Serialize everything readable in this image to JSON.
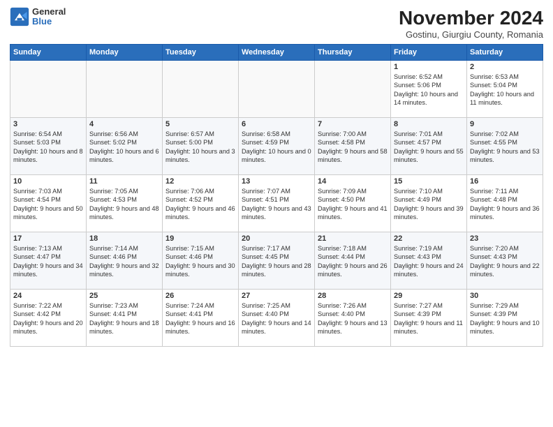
{
  "header": {
    "logo_general": "General",
    "logo_blue": "Blue",
    "title": "November 2024",
    "location": "Gostinu, Giurgiu County, Romania"
  },
  "days_of_week": [
    "Sunday",
    "Monday",
    "Tuesday",
    "Wednesday",
    "Thursday",
    "Friday",
    "Saturday"
  ],
  "weeks": [
    [
      {
        "day": "",
        "info": ""
      },
      {
        "day": "",
        "info": ""
      },
      {
        "day": "",
        "info": ""
      },
      {
        "day": "",
        "info": ""
      },
      {
        "day": "",
        "info": ""
      },
      {
        "day": "1",
        "info": "Sunrise: 6:52 AM\nSunset: 5:06 PM\nDaylight: 10 hours and 14 minutes."
      },
      {
        "day": "2",
        "info": "Sunrise: 6:53 AM\nSunset: 5:04 PM\nDaylight: 10 hours and 11 minutes."
      }
    ],
    [
      {
        "day": "3",
        "info": "Sunrise: 6:54 AM\nSunset: 5:03 PM\nDaylight: 10 hours and 8 minutes."
      },
      {
        "day": "4",
        "info": "Sunrise: 6:56 AM\nSunset: 5:02 PM\nDaylight: 10 hours and 6 minutes."
      },
      {
        "day": "5",
        "info": "Sunrise: 6:57 AM\nSunset: 5:00 PM\nDaylight: 10 hours and 3 minutes."
      },
      {
        "day": "6",
        "info": "Sunrise: 6:58 AM\nSunset: 4:59 PM\nDaylight: 10 hours and 0 minutes."
      },
      {
        "day": "7",
        "info": "Sunrise: 7:00 AM\nSunset: 4:58 PM\nDaylight: 9 hours and 58 minutes."
      },
      {
        "day": "8",
        "info": "Sunrise: 7:01 AM\nSunset: 4:57 PM\nDaylight: 9 hours and 55 minutes."
      },
      {
        "day": "9",
        "info": "Sunrise: 7:02 AM\nSunset: 4:55 PM\nDaylight: 9 hours and 53 minutes."
      }
    ],
    [
      {
        "day": "10",
        "info": "Sunrise: 7:03 AM\nSunset: 4:54 PM\nDaylight: 9 hours and 50 minutes."
      },
      {
        "day": "11",
        "info": "Sunrise: 7:05 AM\nSunset: 4:53 PM\nDaylight: 9 hours and 48 minutes."
      },
      {
        "day": "12",
        "info": "Sunrise: 7:06 AM\nSunset: 4:52 PM\nDaylight: 9 hours and 46 minutes."
      },
      {
        "day": "13",
        "info": "Sunrise: 7:07 AM\nSunset: 4:51 PM\nDaylight: 9 hours and 43 minutes."
      },
      {
        "day": "14",
        "info": "Sunrise: 7:09 AM\nSunset: 4:50 PM\nDaylight: 9 hours and 41 minutes."
      },
      {
        "day": "15",
        "info": "Sunrise: 7:10 AM\nSunset: 4:49 PM\nDaylight: 9 hours and 39 minutes."
      },
      {
        "day": "16",
        "info": "Sunrise: 7:11 AM\nSunset: 4:48 PM\nDaylight: 9 hours and 36 minutes."
      }
    ],
    [
      {
        "day": "17",
        "info": "Sunrise: 7:13 AM\nSunset: 4:47 PM\nDaylight: 9 hours and 34 minutes."
      },
      {
        "day": "18",
        "info": "Sunrise: 7:14 AM\nSunset: 4:46 PM\nDaylight: 9 hours and 32 minutes."
      },
      {
        "day": "19",
        "info": "Sunrise: 7:15 AM\nSunset: 4:46 PM\nDaylight: 9 hours and 30 minutes."
      },
      {
        "day": "20",
        "info": "Sunrise: 7:17 AM\nSunset: 4:45 PM\nDaylight: 9 hours and 28 minutes."
      },
      {
        "day": "21",
        "info": "Sunrise: 7:18 AM\nSunset: 4:44 PM\nDaylight: 9 hours and 26 minutes."
      },
      {
        "day": "22",
        "info": "Sunrise: 7:19 AM\nSunset: 4:43 PM\nDaylight: 9 hours and 24 minutes."
      },
      {
        "day": "23",
        "info": "Sunrise: 7:20 AM\nSunset: 4:43 PM\nDaylight: 9 hours and 22 minutes."
      }
    ],
    [
      {
        "day": "24",
        "info": "Sunrise: 7:22 AM\nSunset: 4:42 PM\nDaylight: 9 hours and 20 minutes."
      },
      {
        "day": "25",
        "info": "Sunrise: 7:23 AM\nSunset: 4:41 PM\nDaylight: 9 hours and 18 minutes."
      },
      {
        "day": "26",
        "info": "Sunrise: 7:24 AM\nSunset: 4:41 PM\nDaylight: 9 hours and 16 minutes."
      },
      {
        "day": "27",
        "info": "Sunrise: 7:25 AM\nSunset: 4:40 PM\nDaylight: 9 hours and 14 minutes."
      },
      {
        "day": "28",
        "info": "Sunrise: 7:26 AM\nSunset: 4:40 PM\nDaylight: 9 hours and 13 minutes."
      },
      {
        "day": "29",
        "info": "Sunrise: 7:27 AM\nSunset: 4:39 PM\nDaylight: 9 hours and 11 minutes."
      },
      {
        "day": "30",
        "info": "Sunrise: 7:29 AM\nSunset: 4:39 PM\nDaylight: 9 hours and 10 minutes."
      }
    ]
  ]
}
